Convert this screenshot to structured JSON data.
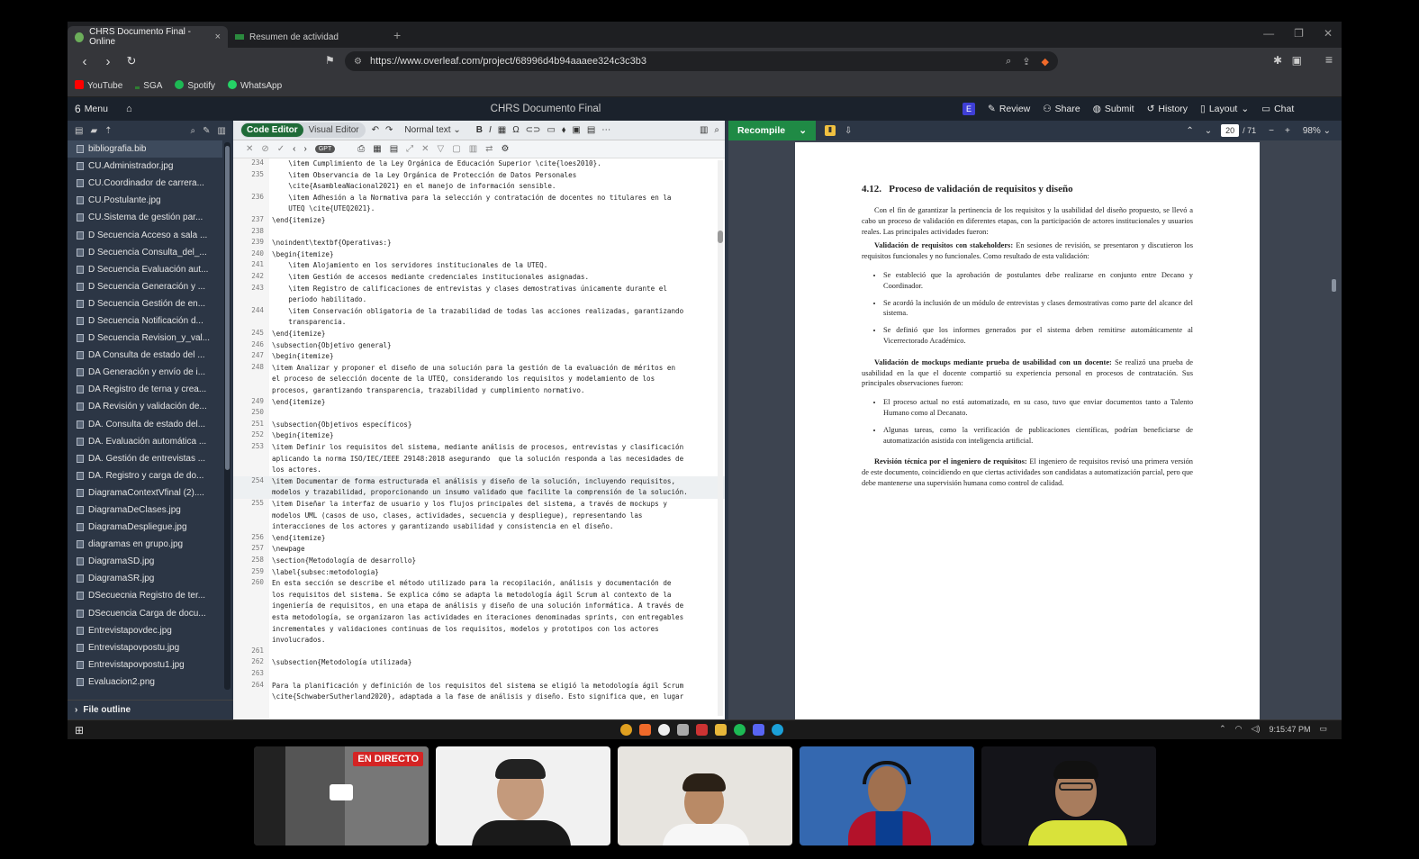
{
  "browser": {
    "tabs": [
      {
        "title": "CHRS Documento Final - Online",
        "active": true
      },
      {
        "title": "Resumen de actividad",
        "active": false
      }
    ],
    "new_tab": "+",
    "url": "https://www.overleaf.com/project/68996d4b94aaaee324c3c3b3",
    "bookmarks": [
      {
        "label": "YouTube",
        "color": "#ff0000"
      },
      {
        "label": "SGA",
        "color": "#2e7d32"
      },
      {
        "label": "Spotify",
        "color": "#1db954"
      },
      {
        "label": "WhatsApp",
        "color": "#25d366"
      }
    ]
  },
  "overleaf": {
    "menu_label": "Menu",
    "project_title": "CHRS Documento Final",
    "user_initial": "E",
    "header_buttons": [
      "Review",
      "Share",
      "Submit",
      "History",
      "Layout",
      "Chat"
    ],
    "editor_modes": {
      "code": "Code Editor",
      "visual": "Visual Editor"
    },
    "text_style": "Normal text",
    "recompile": "Recompile",
    "page_current": "20",
    "page_total": "/ 71",
    "zoom": "98%",
    "file_outline": "File outline",
    "gpt_label": "GPT"
  },
  "files": [
    "bibliografia.bib",
    "CU.Administrador.jpg",
    "CU.Coordinador de carrera...",
    "CU.Postulante.jpg",
    "CU.Sistema de gestión par...",
    "D Secuencia Acceso a sala ...",
    "D Secuencia Consulta_del_...",
    "D Secuencia Evaluación aut...",
    "D Secuencia Generación y ...",
    "D Secuencia Gestión de en...",
    "D Secuencia Notificación d...",
    "D Secuencia Revision_y_val...",
    "DA Consulta de estado del ...",
    "DA Generación y envío de i...",
    "DA Registro de terna y crea...",
    "DA Revisión y validación de...",
    "DA. Consulta de estado del...",
    "DA. Evaluación automática ...",
    "DA. Gestión de entrevistas ...",
    "DA. Registro y carga de do...",
    "DiagramaContextVfinal (2)....",
    "DiagramaDeClases.jpg",
    "DiagramaDespliegue.jpg",
    "diagramas en grupo.jpg",
    "DiagramaSD.jpg",
    "DiagramaSR.jpg",
    "DSecuecnia Registro de ter...",
    "DSecuencia Carga de docu...",
    "Entrevistapovdec.jpg",
    "Entrevistapovpostu.jpg",
    "Entrevistapovpostu1.jpg",
    "Evaluacion2.png"
  ],
  "code_lines": [
    {
      "n": "234",
      "t": "    \\item Cumplimiento de la Ley Orgánica de Educación Superior \\cite{loes2010}."
    },
    {
      "n": "235",
      "t": "    \\item Observancia de la Ley Orgánica de Protección de Datos Personales"
    },
    {
      "n": "",
      "t": "    \\cite{AsambleaNacional2021} en el manejo de información sensible."
    },
    {
      "n": "236",
      "t": "    \\item Adhesión a la Normativa para la selección y contratación de docentes no titulares en la"
    },
    {
      "n": "",
      "t": "    UTEQ \\cite{UTEQ2021}."
    },
    {
      "n": "237",
      "t": "\\end{itemize}"
    },
    {
      "n": "238",
      "t": ""
    },
    {
      "n": "239",
      "t": "\\noindent\\textbf{Operativas:}"
    },
    {
      "n": "240",
      "t": "\\begin{itemize}"
    },
    {
      "n": "241",
      "t": "    \\item Alojamiento en los servidores institucionales de la UTEQ."
    },
    {
      "n": "242",
      "t": "    \\item Gestión de accesos mediante credenciales institucionales asignadas."
    },
    {
      "n": "243",
      "t": "    \\item Registro de calificaciones de entrevistas y clases demostrativas únicamente durante el"
    },
    {
      "n": "",
      "t": "    periodo habilitado."
    },
    {
      "n": "244",
      "t": "    \\item Conservación obligatoria de la trazabilidad de todas las acciones realizadas, garantizando"
    },
    {
      "n": "",
      "t": "    transparencia."
    },
    {
      "n": "245",
      "t": "\\end{itemize}"
    },
    {
      "n": "246",
      "t": "\\subsection{Objetivo general}"
    },
    {
      "n": "247",
      "t": "\\begin{itemize}"
    },
    {
      "n": "248",
      "t": "\\item Analizar y proponer el diseño de una solución para la gestión de la evaluación de méritos en"
    },
    {
      "n": "",
      "t": "el proceso de selección docente de la UTEQ, considerando los requisitos y modelamiento de los"
    },
    {
      "n": "",
      "t": "procesos, garantizando transparencia, trazabilidad y cumplimiento normativo."
    },
    {
      "n": "249",
      "t": "\\end{itemize}"
    },
    {
      "n": "250",
      "t": ""
    },
    {
      "n": "251",
      "t": "\\subsection{Objetivos específicos}"
    },
    {
      "n": "252",
      "t": "\\begin{itemize}"
    },
    {
      "n": "253",
      "t": "\\item Definir los requisitos del sistema, mediante análisis de procesos, entrevistas y clasificación"
    },
    {
      "n": "",
      "t": "aplicando la norma ISO/IEC/IEEE 29148:2018 asegurando  que la solución responda a las necesidades de"
    },
    {
      "n": "",
      "t": "los actores."
    },
    {
      "n": "254",
      "t": "\\item Documentar de forma estructurada el análisis y diseño de la solución, incluyendo requisitos,",
      "hl": true
    },
    {
      "n": "",
      "t": "modelos y trazabilidad, proporcionando un insumo validado que facilite la comprensión de la solución.",
      "hl": true
    },
    {
      "n": "255",
      "t": "\\item Diseñar la interfaz de usuario y los flujos principales del sistema, a través de mockups y"
    },
    {
      "n": "",
      "t": "modelos UML (casos de uso, clases, actividades, secuencia y despliegue), representando las"
    },
    {
      "n": "",
      "t": "interacciones de los actores y garantizando usabilidad y consistencia en el diseño."
    },
    {
      "n": "256",
      "t": "\\end{itemize}"
    },
    {
      "n": "257",
      "t": "\\newpage"
    },
    {
      "n": "258",
      "t": "\\section{Metodología de desarrollo}"
    },
    {
      "n": "259",
      "t": "\\label{subsec:metodologia}"
    },
    {
      "n": "260",
      "t": "En esta sección se describe el método utilizado para la recopilación, análisis y documentación de"
    },
    {
      "n": "",
      "t": "los requisitos del sistema. Se explica cómo se adapta la metodología ágil Scrum al contexto de la"
    },
    {
      "n": "",
      "t": "ingeniería de requisitos, en una etapa de análisis y diseño de una solución informática. A través de"
    },
    {
      "n": "",
      "t": "esta metodología, se organizaron las actividades en iteraciones denominadas sprints, con entregables"
    },
    {
      "n": "",
      "t": "incrementales y validaciones continuas de los requisitos, modelos y prototipos con los actores"
    },
    {
      "n": "",
      "t": "involucrados."
    },
    {
      "n": "261",
      "t": ""
    },
    {
      "n": "262",
      "t": "\\subsection{Metodología utilizada}"
    },
    {
      "n": "263",
      "t": ""
    },
    {
      "n": "264",
      "t": "Para la planificación y definición de los requisitos del sistema se eligió la metodología ágil Scrum"
    },
    {
      "n": "",
      "t": "\\cite{SchwaberSutherland2020}, adaptada a la fase de análisis y diseño. Esto significa que, en lugar"
    }
  ],
  "pdf": {
    "section_num": "4.12.",
    "section_title": "Proceso de validación de requisitos y diseño",
    "intro": "Con el fin de garantizar la pertinencia de los requisitos y la usabilidad del diseño propuesto, se llevó a cabo un proceso de validación en diferentes etapas, con la participación de actores institucionales y usuarios reales. Las principales actividades fueron:",
    "p1_bold": "Validación de requisitos con stakeholders:",
    "p1": " En sesiones de revisión, se presentaron y discutieron los requisitos funcionales y no funcionales. Como resultado de esta validación:",
    "bullets1": [
      "Se estableció que la aprobación de postulantes debe realizarse en conjunto entre Decano y Coordinador.",
      "Se acordó la inclusión de un módulo de entrevistas y clases demostrativas como parte del alcance del sistema.",
      "Se definió que los informes generados por el sistema deben remitirse automáticamente al Vicerrectorado Académico."
    ],
    "p2_bold": "Validación de mockups mediante prueba de usabilidad con un docente:",
    "p2": " Se realizó una prueba de usabilidad en la que el docente compartió su experiencia personal en procesos de contratación. Sus principales observaciones fueron:",
    "bullets2": [
      "El proceso actual no está automatizado, en su caso, tuvo que enviar documentos tanto a Talento Humano como al Decanato.",
      "Algunas tareas, como la verificación de publicaciones científicas, podrían beneficiarse de automatización asistida con inteligencia artificial."
    ],
    "p3_bold": "Revisión técnica por el ingeniero de requisitos:",
    "p3": " El ingeniero de requisitos revisó una primera versión de este documento, coincidiendo en que ciertas actividades son candidatas a automatización parcial, pero que debe mantenerse una supervisión humana como control de calidad."
  },
  "taskbar": {
    "time": "9:15:47 PM"
  },
  "meeting": {
    "live_label": "EN DIRECTO"
  }
}
